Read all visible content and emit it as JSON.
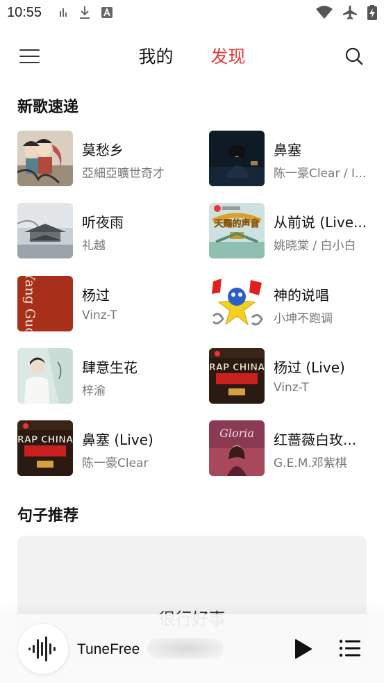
{
  "status_bar": {
    "time": "10:55",
    "icons": [
      "signal-bars-icon",
      "download-icon",
      "font-a-icon",
      "wifi-icon",
      "airplane-icon",
      "battery-charging-icon"
    ]
  },
  "header": {
    "menu_icon": "hamburger-menu-icon",
    "tabs": [
      {
        "label": "我的",
        "active": false
      },
      {
        "label": "发现",
        "active": true
      }
    ],
    "search_icon": "search-icon",
    "accent_color": "#e53935"
  },
  "new_songs": {
    "title": "新歌速递",
    "items": [
      {
        "title": "莫愁乡",
        "artist": "亞細亞曠世奇才"
      },
      {
        "title": "鼻塞",
        "artist": "陈一豪Clear / I..."
      },
      {
        "title": "听夜雨",
        "artist": "礼越"
      },
      {
        "title": "从前说 (Live...",
        "artist": "姚晓棠 / 白小白"
      },
      {
        "title": "杨过",
        "artist": "Vinz-T"
      },
      {
        "title": "神的说唱",
        "artist": "小坤不跑调"
      },
      {
        "title": "肆意生花",
        "artist": "梓渝"
      },
      {
        "title": "杨过 (Live)",
        "artist": "Vinz-T"
      },
      {
        "title": "鼻塞 (Live)",
        "artist": "陈一豪Clear"
      },
      {
        "title": "红蔷薇白玫...",
        "artist": "G.E.M.邓紫棋"
      }
    ],
    "cover_text": {
      "yang_guo": "Yang Guo",
      "rap_of_china": "RAP CHINA",
      "voice": "天赐的声音",
      "gloria": "Gloria"
    }
  },
  "sentences": {
    "title": "句子推荐",
    "text": "很行好事"
  },
  "player": {
    "title": "TuneFree",
    "art_icon": "sound-wave-icon",
    "play_icon": "play-icon",
    "queue_icon": "playlist-icon"
  }
}
